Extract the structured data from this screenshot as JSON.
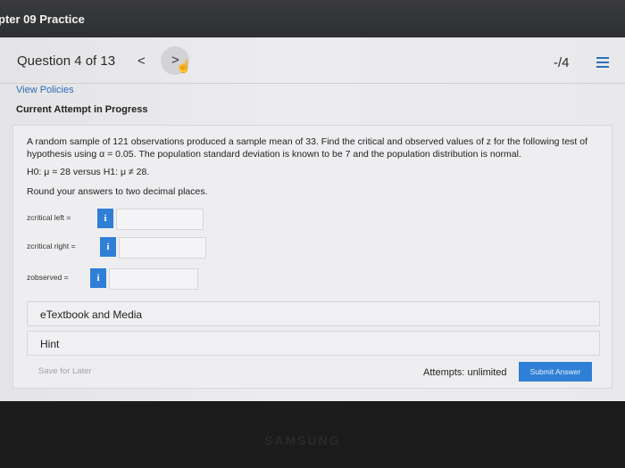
{
  "window": {
    "title": "pter 09 Practice"
  },
  "header": {
    "question_label": "Question 4 of 13",
    "prev_label": "<",
    "next_label": ">",
    "score": "-/4"
  },
  "view_policies": "View Policies",
  "attempt_title": "Current Attempt in Progress",
  "problem": {
    "text": "A random sample of 121 observations produced a sample mean of 33. Find the critical and observed values of z for the following test of hypothesis using α = 0.05. The population standard deviation is known to be 7 and the population distribution is normal.",
    "hypothesis": "H0: μ = 28 versus H1: μ ≠ 28.",
    "rounding": "Round your answers to two decimal places."
  },
  "answers": [
    {
      "label": "zcritical left =",
      "info": "i",
      "value": ""
    },
    {
      "label": "zcritical right =",
      "info": "i",
      "value": ""
    },
    {
      "label": "zobserved =",
      "info": "i",
      "value": ""
    }
  ],
  "links": {
    "etextbook": "eTextbook and Media",
    "hint": "Hint"
  },
  "footer": {
    "save_later": "Save for Later",
    "attempts": "Attempts: unlimited",
    "submit": "Submit Answer"
  },
  "bezel_brand": "SAMSUNG",
  "colors": {
    "accent": "#2f7fd6",
    "link": "#2d6cb5"
  },
  "icons": {
    "list": "list-icon",
    "hand_cursor": "hand-cursor-icon",
    "info": "info-icon"
  }
}
